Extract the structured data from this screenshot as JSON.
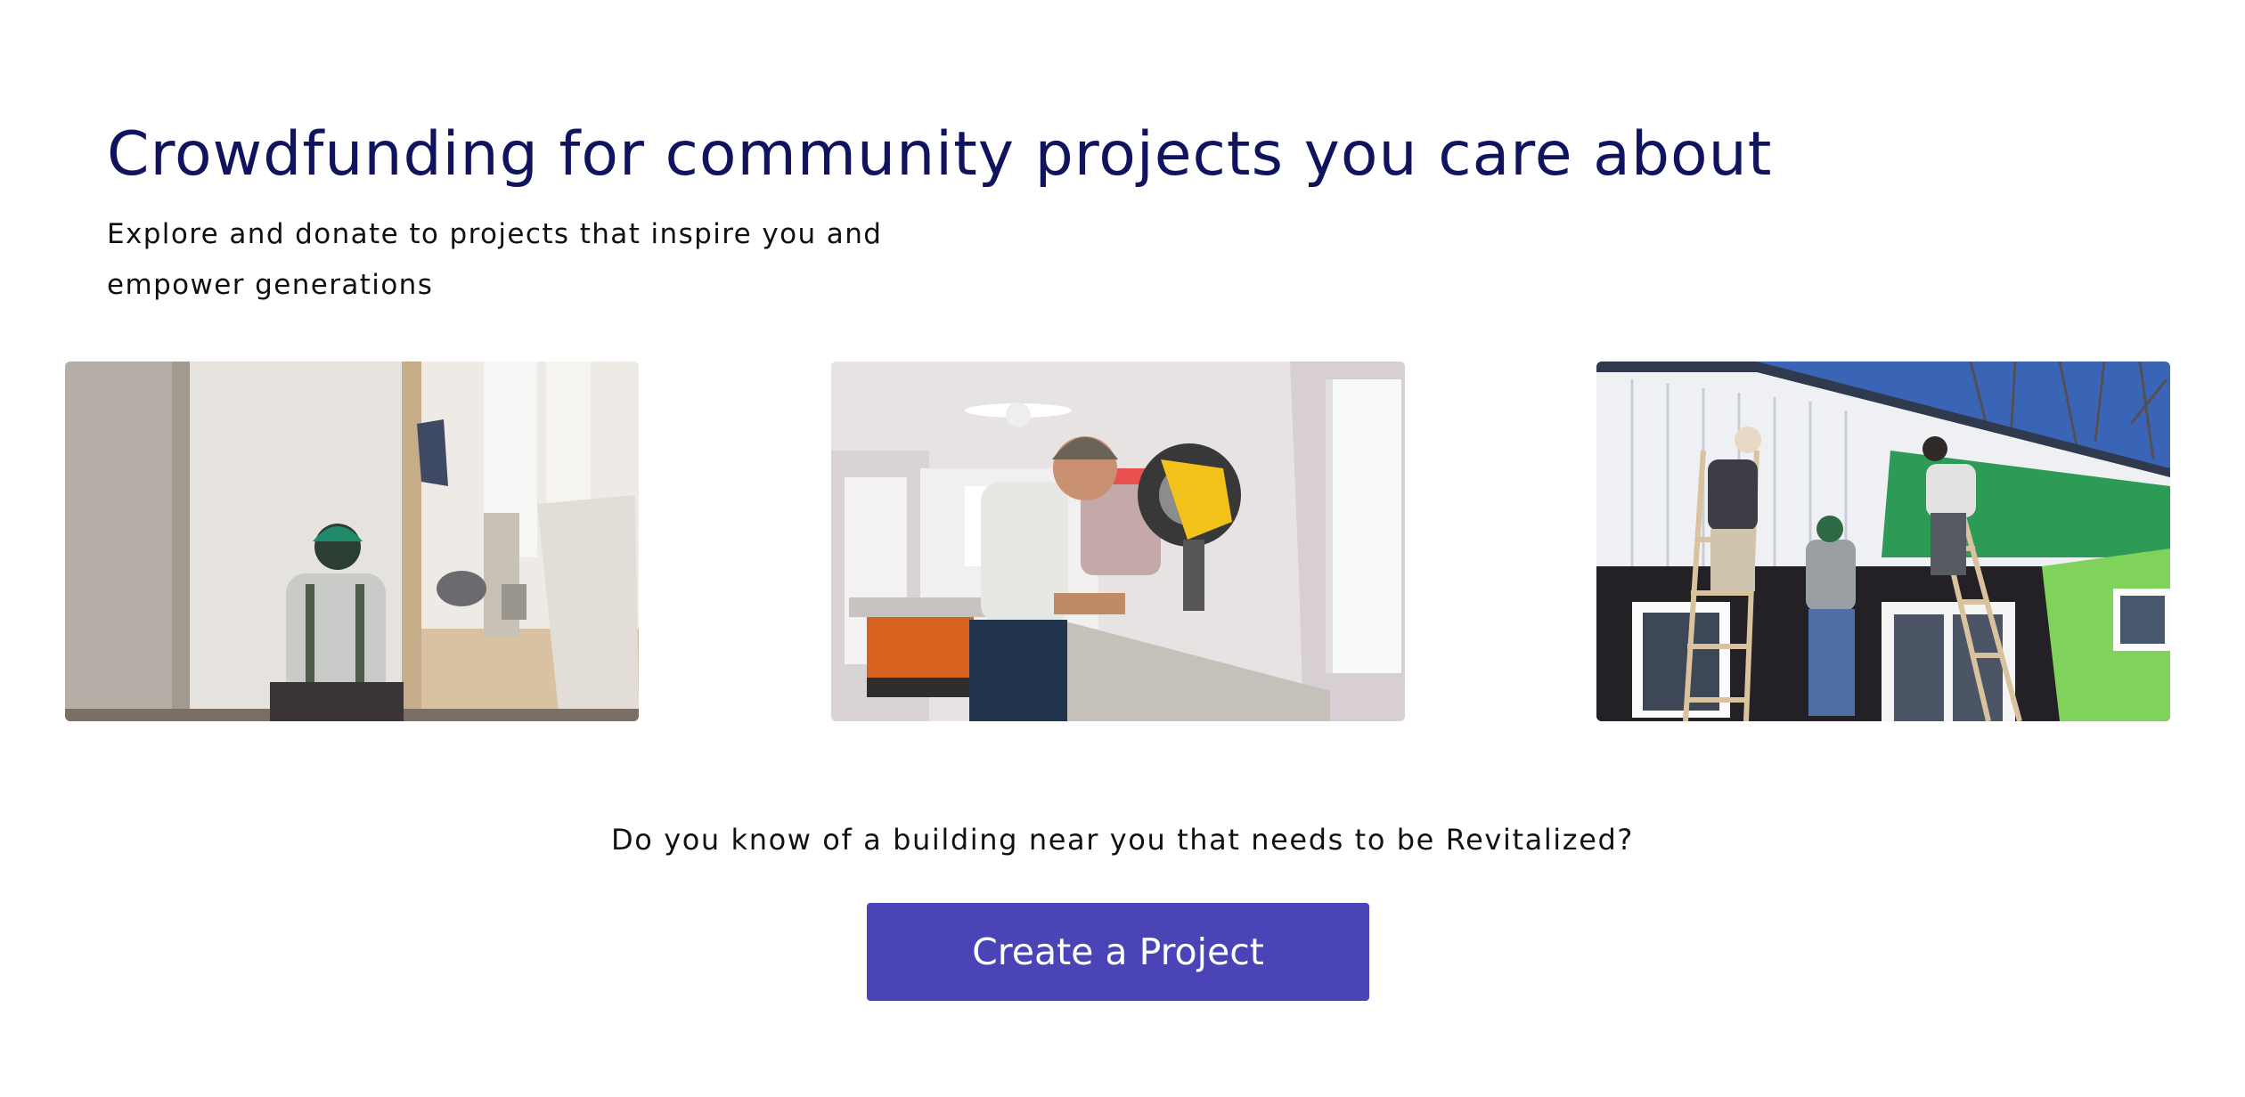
{
  "hero": {
    "title": "Crowdfunding for community projects you care about",
    "subtitle": "Explore and donate to projects that inspire you and empower generations"
  },
  "gallery": {
    "photos": [
      {
        "name": "drywall-worker-photo"
      },
      {
        "name": "miter-saw-workers-photo"
      },
      {
        "name": "ladder-siding-workers-photo"
      }
    ]
  },
  "cta": {
    "prompt": "Do you know of a building near you that needs to be Revitalized?",
    "button_label": "Create a Project"
  },
  "colors": {
    "title": "#10135e",
    "button": "#4a44b6",
    "text": "#111111",
    "background": "#ffffff"
  }
}
